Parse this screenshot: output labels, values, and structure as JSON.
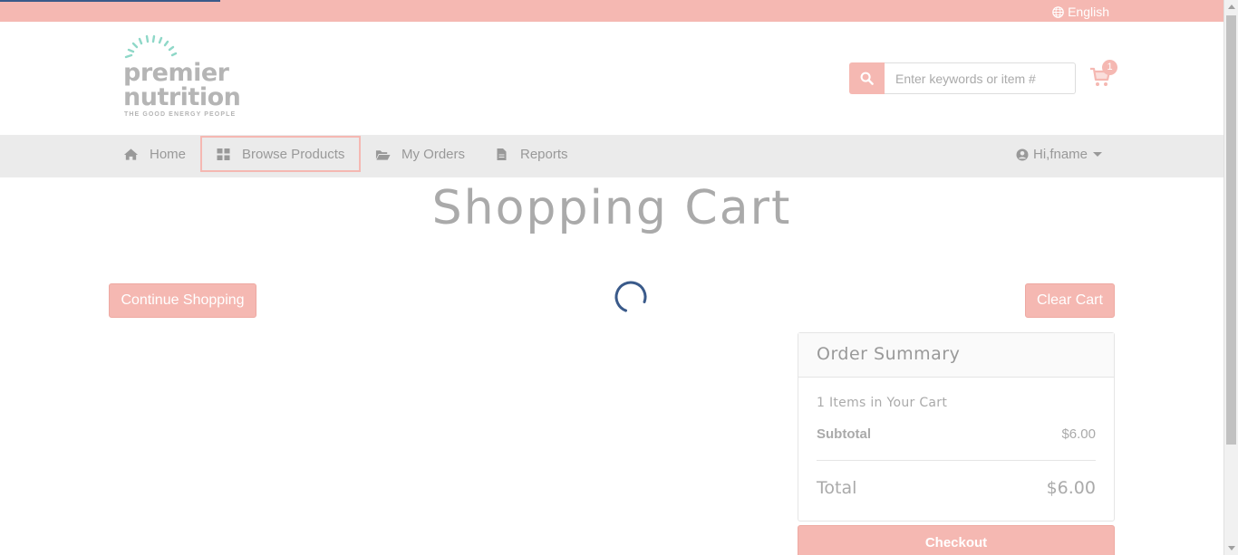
{
  "topbar": {
    "language_label": "English",
    "language_icon": "globe-icon"
  },
  "header": {
    "logo": {
      "word1": "premier",
      "word2": "nutrition",
      "tagline": "THE GOOD ENERGY PEOPLE",
      "ray_color": "#8fd8c8",
      "text_color": "#b5b5b5"
    },
    "search": {
      "placeholder": "Enter keywords or item #",
      "value": "",
      "icon": "search-icon"
    },
    "cart": {
      "icon": "shopping-cart-icon",
      "count": "1"
    }
  },
  "nav": {
    "items": [
      {
        "label": "Home",
        "icon": "home-icon"
      },
      {
        "label": "Browse Products",
        "icon": "grid-icon"
      },
      {
        "label": "My Orders",
        "icon": "folder-open-icon"
      },
      {
        "label": "Reports",
        "icon": "file-icon"
      }
    ],
    "user": {
      "label": "Hi,fname",
      "icon": "user-circle-icon"
    }
  },
  "main": {
    "title": "Shopping Cart",
    "continue_label": "Continue Shopping",
    "clear_label": "Clear Cart",
    "loading_icon": "spinner-icon"
  },
  "summary": {
    "heading": "Order Summary",
    "item_count": "1 Items in Your Cart",
    "subtotal_label": "Subtotal",
    "subtotal_value": "$6.00",
    "total_label": "Total",
    "total_value": "$6.00",
    "checkout_label": "Checkout"
  },
  "colors": {
    "accent": "#f5b8b2",
    "nav_background": "#ebebeb",
    "spinner": "#3a5a8a"
  }
}
